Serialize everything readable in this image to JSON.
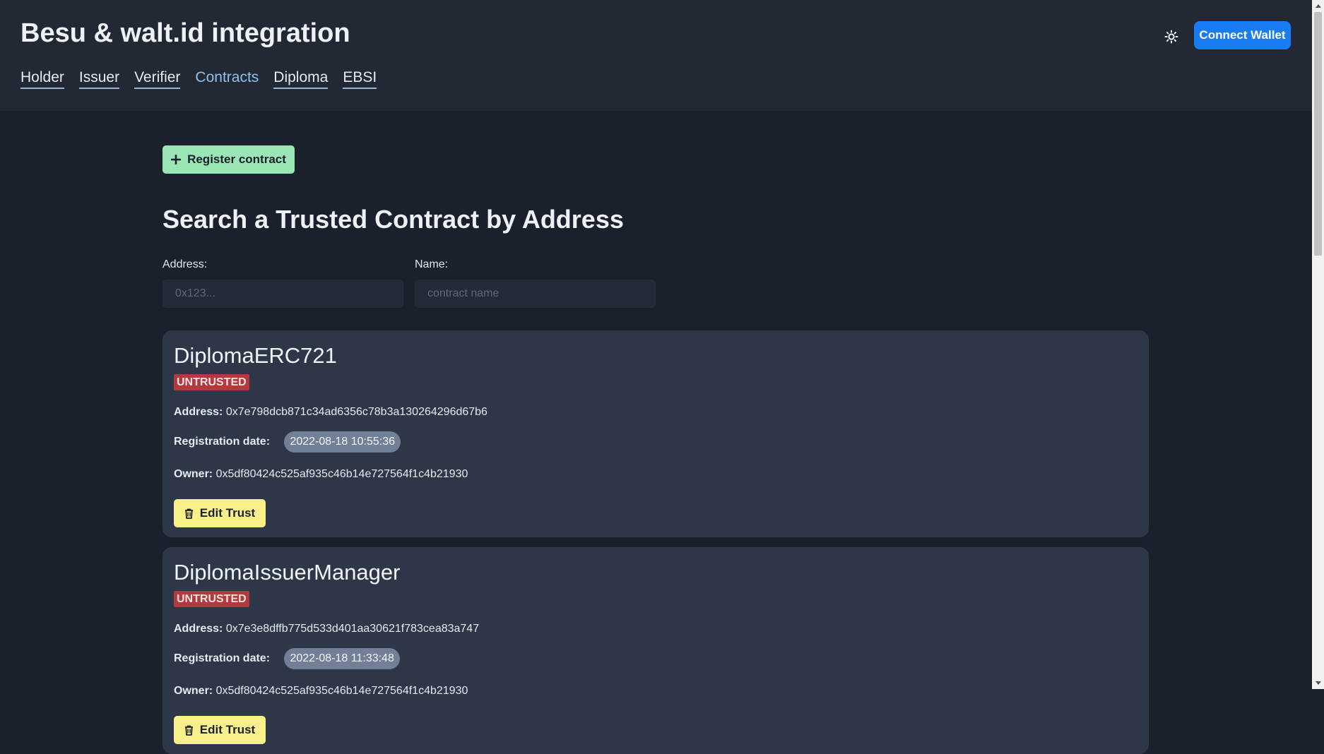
{
  "header": {
    "title": "Besu & walt.id integration",
    "nav": [
      "Holder",
      "Issuer",
      "Verifier",
      "Contracts",
      "Diploma",
      "EBSI"
    ],
    "active_nav": "Contracts",
    "connect_wallet_label": "Connect Wallet"
  },
  "actions": {
    "register_label": "Register contract"
  },
  "search": {
    "title": "Search a Trusted Contract by Address",
    "address_label": "Address:",
    "address_placeholder": "0x123...",
    "address_value": "",
    "name_label": "Name:",
    "name_placeholder": "contract name",
    "name_value": ""
  },
  "contracts": [
    {
      "name": "DiplomaERC721",
      "status": "UNTRUSTED",
      "address_label": "Address:",
      "address": "0x7e798dcb871c34ad6356c78b3a130264296d67b6",
      "registration_label": "Registration date:",
      "registration_date": "2022-08-18 10:55:36",
      "owner_label": "Owner:",
      "owner": "0x5df80424c525af935c46b14e727564f1c4b21930",
      "edit_label": "Edit Trust"
    },
    {
      "name": "DiplomaIssuerManager",
      "status": "UNTRUSTED",
      "address_label": "Address:",
      "address": "0x7e3e8dffb775d533d401aa30621f783cea83a747",
      "registration_label": "Registration date:",
      "registration_date": "2022-08-18 11:33:48",
      "owner_label": "Owner:",
      "owner": "0x5df80424c525af935c46b14e727564f1c4b21930",
      "edit_label": "Edit Trust"
    }
  ],
  "colors": {
    "background": "#1a202c",
    "header_bg": "#222834",
    "card_bg": "#2d3748",
    "primary": "#1a7cf5",
    "register_green": "#9ae6b4",
    "edit_yellow": "#faf089",
    "untrusted_red": "#b23a3f",
    "nav_active": "#8fc1ee"
  },
  "icons": {
    "theme_toggle": "sun-icon",
    "register": "plus-icon",
    "edit": "trash-icon"
  }
}
